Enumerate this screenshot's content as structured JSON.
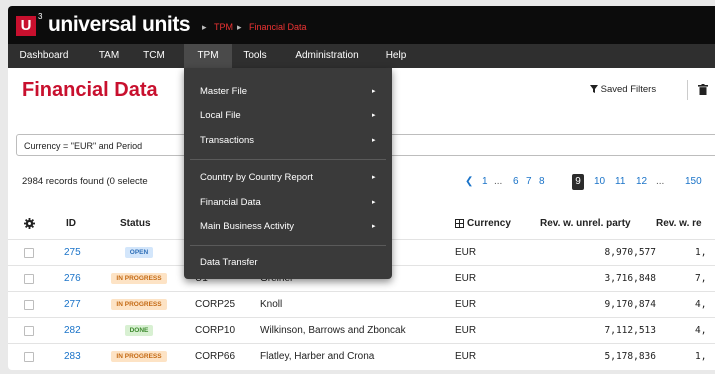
{
  "brand": {
    "logo_letter": "U",
    "logo_sup": "3",
    "name": "universal units",
    "breadcrumb": [
      {
        "sep": "▸",
        "label": "TPM"
      },
      {
        "sep": "▸",
        "label": "Financial Data"
      }
    ]
  },
  "menu": [
    {
      "label": "Dashboard",
      "active": false
    },
    {
      "label": "TAM",
      "active": false
    },
    {
      "label": "TCM",
      "active": false
    },
    {
      "label": "TPM",
      "active": true
    },
    {
      "label": "Tools",
      "active": false
    },
    {
      "label": "Administration",
      "active": false
    },
    {
      "label": "Help",
      "active": false
    }
  ],
  "page": {
    "title": "Financial Data",
    "saved_filters_label": "Saved Filters",
    "saved_filters_icon": "filter-icon",
    "trash_icon": "trash-icon"
  },
  "filter": {
    "text": "Currency = \"EUR\" and Period"
  },
  "records": {
    "text": "2984 records found (0 selecte"
  },
  "pagination": {
    "prev": "❮",
    "pages": [
      "1",
      "...",
      "6",
      "7",
      "8",
      "9",
      "10",
      "11",
      "12",
      "...",
      "150"
    ],
    "current": "9"
  },
  "table": {
    "settings_icon": "gear-icon",
    "headers": {
      "id": "ID",
      "status": "Status",
      "currency_icon": "currency-icon",
      "currency": "Currency",
      "rev_unrel": "Rev. w. unrel. party",
      "rev_rel": "Rev. w. re"
    },
    "rows": [
      {
        "id": "275",
        "status": "OPEN",
        "status_bg": "#d3e6fb",
        "status_fg": "#2f6fb7",
        "code": "",
        "name": "",
        "currency": "EUR",
        "rev_unrel": "8,970,577",
        "rev_rel": "1,"
      },
      {
        "id": "276",
        "status": "IN PROGRESS",
        "status_bg": "#fde3c5",
        "status_fg": "#c46a14",
        "code": "U1",
        "name": "Greiner",
        "currency": "EUR",
        "rev_unrel": "3,716,848",
        "rev_rel": "7,"
      },
      {
        "id": "277",
        "status": "IN PROGRESS",
        "status_bg": "#fde3c5",
        "status_fg": "#c46a14",
        "code": "CORP25",
        "name": "Knoll",
        "currency": "EUR",
        "rev_unrel": "9,170,874",
        "rev_rel": "4,"
      },
      {
        "id": "282",
        "status": "DONE",
        "status_bg": "#d8f0d2",
        "status_fg": "#3d8a2e",
        "code": "CORP10",
        "name": "Wilkinson, Barrows and Zboncak",
        "currency": "EUR",
        "rev_unrel": "7,112,513",
        "rev_rel": "4,"
      },
      {
        "id": "283",
        "status": "IN PROGRESS",
        "status_bg": "#fde3c5",
        "status_fg": "#c46a14",
        "code": "CORP66",
        "name": "Flatley, Harber and Crona",
        "currency": "EUR",
        "rev_unrel": "5,178,836",
        "rev_rel": "1,"
      }
    ]
  },
  "dropdown": {
    "groups": [
      [
        {
          "label": "Master File",
          "has_sub": true
        },
        {
          "label": "Local File",
          "has_sub": true
        },
        {
          "label": "Transactions",
          "has_sub": true
        }
      ],
      [
        {
          "label": "Country by Country Report",
          "has_sub": true
        },
        {
          "label": "Financial Data",
          "has_sub": true
        },
        {
          "label": "Main Business Activity",
          "has_sub": true
        }
      ],
      [
        {
          "label": "Data Transfer",
          "has_sub": false
        }
      ]
    ],
    "arrow": "▸"
  },
  "colors": {
    "brand_red": "#c8102e",
    "link_blue": "#1a73c8",
    "menu_bg": "#2f2f2f",
    "dropdown_bg": "#3a3a3a"
  }
}
